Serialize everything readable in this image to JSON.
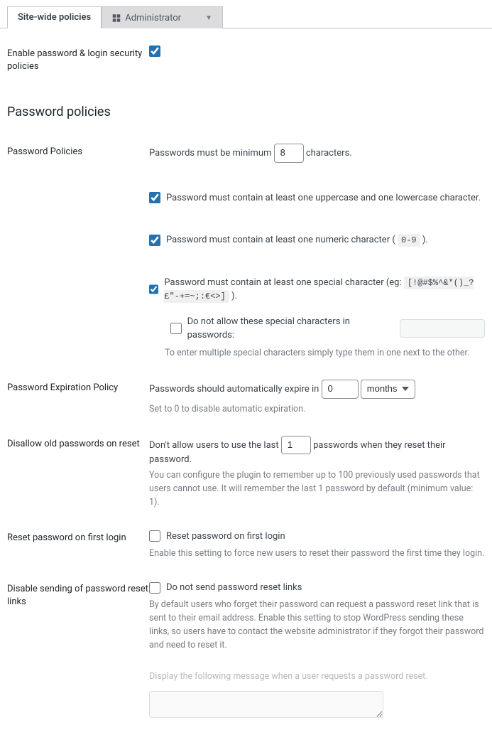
{
  "tabs": {
    "sitewide": "Site-wide policies",
    "admin": "Administrator"
  },
  "enable": {
    "label": "Enable password & login security policies",
    "checked": true
  },
  "section_title": "Password policies",
  "policies": {
    "label": "Password Policies",
    "min_pre": "Passwords must be minimum",
    "min_value": "8",
    "min_post": "characters.",
    "case_checked": true,
    "case_text": "Password must contain at least one uppercase and one lowercase character.",
    "numeric_checked": true,
    "numeric_text_pre": "Password must contain at least one numeric character (",
    "numeric_code": "0-9",
    "numeric_text_post": ").",
    "special_checked": true,
    "special_text_pre": "Password must contain at least one special character (eg:",
    "special_code": "[!@#$%^&*()_?£\"-+=~;:€<>]",
    "special_text_post": ").",
    "disallow_special_checked": false,
    "disallow_special_text": "Do not allow these special characters in passwords:",
    "disallow_special_value": "",
    "disallow_special_desc": "To enter multiple special characters simply type them in one next to the other."
  },
  "expiration": {
    "label": "Password Expiration Policy",
    "pre": "Passwords should automatically expire in",
    "value": "0",
    "unit": "months",
    "desc": "Set to 0 to disable automatic expiration."
  },
  "disallow_old": {
    "label": "Disallow old passwords on reset",
    "pre": "Don't allow users to use the last",
    "value": "1",
    "post": "passwords when they reset their password.",
    "desc": "You can configure the plugin to remember up to 100 previously used passwords that users cannot use. It will remember the last 1 password by default (minimum value: 1)."
  },
  "first_login": {
    "label": "Reset password on first login",
    "checked": false,
    "text": "Reset password on first login",
    "desc": "Enable this setting to force new users to reset their password the first time they login."
  },
  "disable_reset": {
    "label": "Disable sending of password reset links",
    "checked": false,
    "text": "Do not send password reset links",
    "desc": "By default users who forget their password can request a password reset link that is sent to their email address. Enable this setting to stop WordPress sending these links, so users have to contact the website administrator if they forgot their password and need to reset it.",
    "msg_label": "Display the following message when a user requests a password reset.",
    "msg_value": ""
  }
}
